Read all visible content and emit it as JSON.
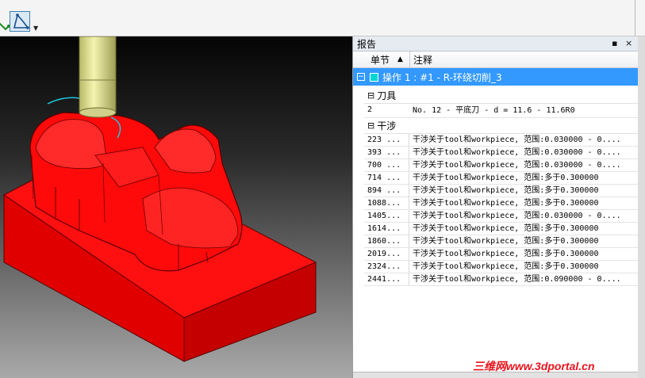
{
  "toolbar": {
    "icons": [
      "toolpath-icon",
      "select-curve-icon"
    ],
    "dropdown_icon": "chevron-down-icon"
  },
  "viewport": {
    "model_color": "#ff0000",
    "tool_color": "#e3e38f"
  },
  "report": {
    "title": "报告",
    "pin_glyph": "\u0004",
    "close_glyph": "×",
    "columns": {
      "section": "单节",
      "comment": "注释"
    },
    "operation": {
      "label": "操作 1 : #1 - R-环绕切削_3",
      "accent": "#3399ff"
    },
    "tool_section": {
      "title": "刀具",
      "row": {
        "id": "2",
        "text": "No. 12 - 平底刀 - d = 11.6 - 11.6R0"
      }
    },
    "interference_section": {
      "title": "干涉",
      "rows": [
        {
          "id": "223 ...",
          "text": "干涉关于tool和workpiece, 范围:0.030000 - 0...."
        },
        {
          "id": "393 ...",
          "text": "干涉关于tool和workpiece, 范围:0.030000 - 0...."
        },
        {
          "id": "700 ...",
          "text": "干涉关于tool和workpiece, 范围:0.030000 - 0...."
        },
        {
          "id": "714 ...",
          "text": "干涉关于tool和workpiece, 范围:多于0.300000"
        },
        {
          "id": "894 ...",
          "text": "干涉关于tool和workpiece, 范围:多于0.300000"
        },
        {
          "id": "1088...",
          "text": "干涉关于tool和workpiece, 范围:多于0.300000"
        },
        {
          "id": "1405...",
          "text": "干涉关于tool和workpiece, 范围:0.030000 - 0...."
        },
        {
          "id": "1614...",
          "text": "干涉关于tool和workpiece, 范围:多于0.300000"
        },
        {
          "id": "1860...",
          "text": "干涉关于tool和workpiece, 范围:多于0.300000"
        },
        {
          "id": "2019...",
          "text": "干涉关于tool和workpiece, 范围:多于0.300000"
        },
        {
          "id": "2324...",
          "text": "干涉关于tool和workpiece, 范围:多于0.300000"
        },
        {
          "id": "2441...",
          "text": "干涉关于tool和workpiece, 范围:0.090000 - 0...."
        }
      ]
    }
  },
  "watermark": "三维网www.3dportal.cn"
}
